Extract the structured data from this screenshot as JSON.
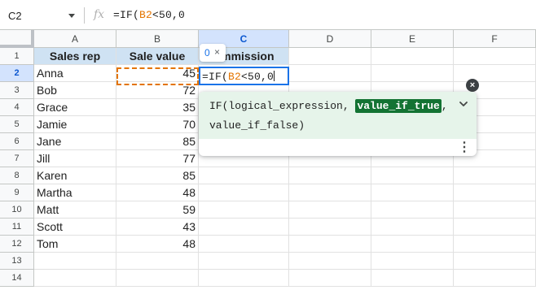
{
  "formula_bar": {
    "cell_ref": "C2",
    "fx_icon": "fx-icon",
    "formula_prefix": "=IF(",
    "formula_ref": "B2",
    "formula_suffix": "<50,0"
  },
  "columns": [
    "A",
    "B",
    "C",
    "D",
    "E",
    "F"
  ],
  "selected_column": "C",
  "rows": [
    "1",
    "2",
    "3",
    "4",
    "5",
    "6",
    "7",
    "8",
    "9",
    "10",
    "11",
    "12",
    "13",
    "14"
  ],
  "selected_row": "2",
  "sheet": {
    "header": {
      "a": "Sales rep",
      "b": "Sale value",
      "c": "Commission"
    },
    "data": [
      {
        "a": "Anna",
        "b": "45"
      },
      {
        "a": "Bob",
        "b": "72"
      },
      {
        "a": "Grace",
        "b": "35"
      },
      {
        "a": "Jamie",
        "b": "70"
      },
      {
        "a": "Jane",
        "b": "85"
      },
      {
        "a": "Jill",
        "b": "77"
      },
      {
        "a": "Karen",
        "b": "85"
      },
      {
        "a": "Martha",
        "b": "48"
      },
      {
        "a": "Matt",
        "b": "59"
      },
      {
        "a": "Scott",
        "b": "43"
      },
      {
        "a": "Tom",
        "b": "48"
      }
    ]
  },
  "active_cell": {
    "prefix": "=IF(",
    "ref": "B2",
    "suffix": "<50,0"
  },
  "preview_chip": {
    "value": "0",
    "close": "×"
  },
  "formula_help": {
    "line1_prefix": "IF(logical_expression, ",
    "current_arg": "value_if_true",
    "line1_suffix": ",",
    "line2": "value_if_false)",
    "expand_icon": "chevron-down-icon",
    "menu": "⋮",
    "close": "×"
  },
  "colors": {
    "header_fill": "#cfe2f3",
    "range_highlight": "#e37400",
    "active_border": "#1a73e8",
    "help_background": "#e6f4ea",
    "current_arg": "#137333"
  }
}
